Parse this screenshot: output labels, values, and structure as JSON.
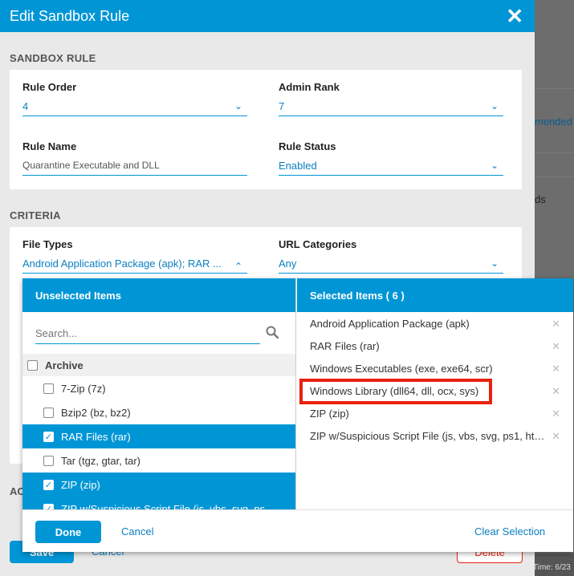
{
  "background": {
    "texts": [
      "mended",
      "ds"
    ],
    "footer_stamp": "Time: 6/23"
  },
  "modal": {
    "title": "Edit Sandbox Rule",
    "close_glyph": "✕",
    "sandbox_section": "SANDBOX RULE",
    "criteria_section": "CRITERIA",
    "actions_section_partial": "AC",
    "fields": {
      "rule_order": {
        "label": "Rule Order",
        "value": "4"
      },
      "admin_rank": {
        "label": "Admin Rank",
        "value": "7"
      },
      "rule_name": {
        "label": "Rule Name",
        "value": "Quarantine Executable and DLL"
      },
      "rule_status": {
        "label": "Rule Status",
        "value": "Enabled"
      },
      "file_types": {
        "label": "File Types",
        "value": "Android Application Package (apk); RAR ..."
      },
      "url_categories": {
        "label": "URL Categories",
        "value": "Any"
      }
    },
    "buttons": {
      "save": "Save",
      "cancel": "Cancel",
      "delete": "Delete"
    }
  },
  "dropdown": {
    "unselected_header": "Unselected Items",
    "selected_header": "Selected Items ( 6 )",
    "search_placeholder": "Search...",
    "unselected": [
      {
        "label": "Archive",
        "group": true,
        "checked": false
      },
      {
        "label": "7-Zip (7z)",
        "group": false,
        "checked": false
      },
      {
        "label": "Bzip2 (bz, bz2)",
        "group": false,
        "checked": false
      },
      {
        "label": "RAR Files (rar)",
        "group": false,
        "checked": true
      },
      {
        "label": "Tar (tgz, gtar, tar)",
        "group": false,
        "checked": false
      },
      {
        "label": "ZIP (zip)",
        "group": false,
        "checked": true
      },
      {
        "label": "ZIP w/Suspicious Script File (js, vbs, svg, ps",
        "group": false,
        "checked": true
      }
    ],
    "selected": [
      "Android Application Package (apk)",
      "RAR Files (rar)",
      "Windows Executables (exe, exe64, scr)",
      "Windows Library (dll64, dll, ocx, sys)",
      "ZIP (zip)",
      "ZIP w/Suspicious Script File (js, vbs, svg, ps1, ht…"
    ],
    "remove_glyph": "✕",
    "check_glyph": "✓",
    "chevron_glyph": "⌄",
    "chevron_up_glyph": "⌃",
    "done": "Done",
    "cancel": "Cancel",
    "clear_selection": "Clear Selection"
  },
  "colors": {
    "accent": "#0096d6",
    "highlight": "#e8210e"
  }
}
